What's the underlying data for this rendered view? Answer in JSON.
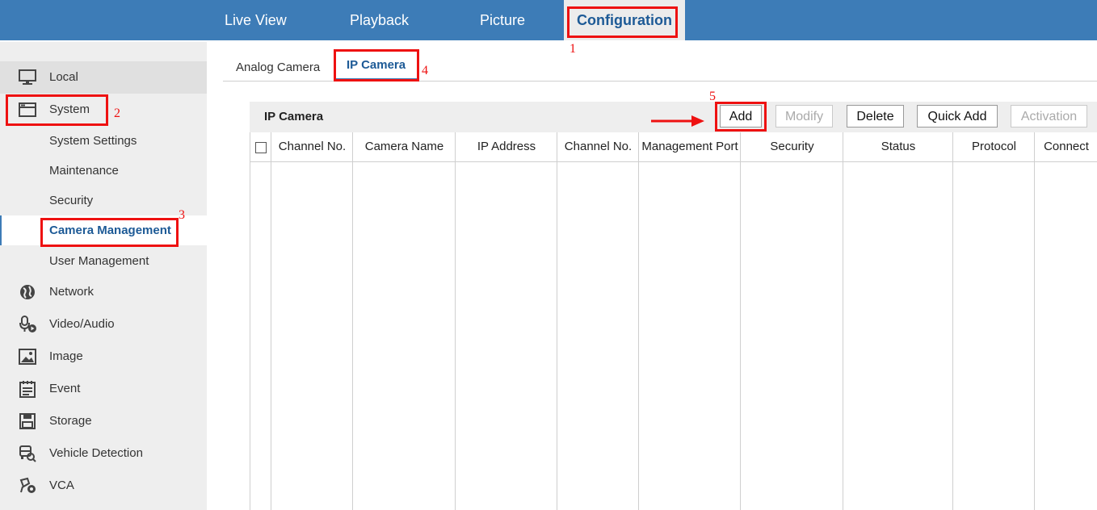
{
  "top_nav": {
    "items": [
      {
        "label": "Live View"
      },
      {
        "label": "Playback"
      },
      {
        "label": "Picture"
      },
      {
        "label": "Configuration",
        "active": true
      }
    ]
  },
  "sidebar": {
    "items": [
      {
        "label": "Local",
        "icon": "monitor-icon"
      },
      {
        "label": "System",
        "icon": "window-icon"
      },
      {
        "label": "System Settings"
      },
      {
        "label": "Maintenance"
      },
      {
        "label": "Security"
      },
      {
        "label": "Camera Management",
        "active": true
      },
      {
        "label": "User Management"
      },
      {
        "label": "Network",
        "icon": "globe-icon"
      },
      {
        "label": "Video/Audio",
        "icon": "microphone-icon"
      },
      {
        "label": "Image",
        "icon": "image-icon"
      },
      {
        "label": "Event",
        "icon": "calendar-icon"
      },
      {
        "label": "Storage",
        "icon": "disk-icon"
      },
      {
        "label": "Vehicle Detection",
        "icon": "vehicle-search-icon"
      },
      {
        "label": "VCA",
        "icon": "vca-icon"
      }
    ]
  },
  "tabs": [
    {
      "label": "Analog Camera"
    },
    {
      "label": "IP Camera",
      "active": true
    }
  ],
  "panel": {
    "title": "IP Camera",
    "buttons": {
      "add": "Add",
      "modify": "Modify",
      "delete": "Delete",
      "quick_add": "Quick Add",
      "activation": "Activation"
    },
    "columns": [
      "Channel No.",
      "Camera Name",
      "IP Address",
      "Channel No.",
      "Management Port",
      "Security",
      "Status",
      "Protocol",
      "Connect"
    ]
  },
  "annotations": {
    "step1": "1",
    "step2": "2",
    "step3": "3",
    "step4": "4",
    "step5": "5",
    "color": "#ee1111"
  },
  "colors": {
    "topbar": "#3d7cb7",
    "active_text": "#1d5a96",
    "sidebar_bg": "#eeeeee"
  }
}
